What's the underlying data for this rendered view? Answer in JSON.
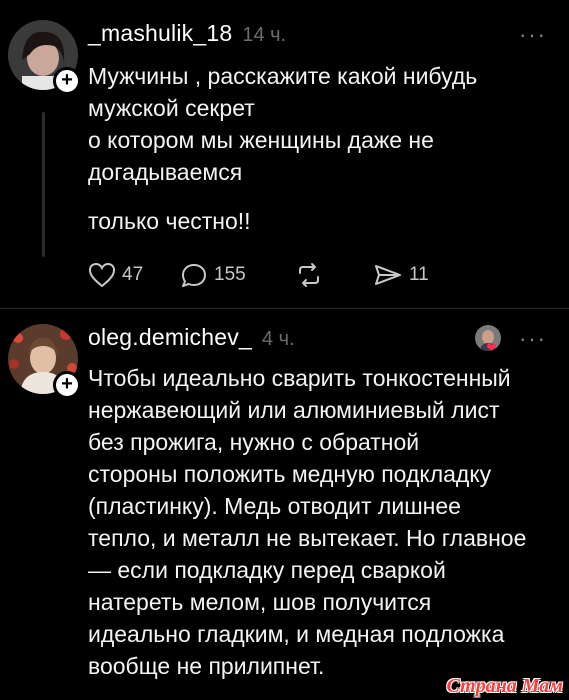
{
  "post1": {
    "username": "_mashulik_18",
    "time": "14 ч.",
    "more": "···",
    "text": "Мужчины , расскажите какой нибудь\nмужской секрет\nо котором мы женщины  даже не\nдогадываемся",
    "text2": "только честно!!",
    "likes": "47",
    "comments": "155",
    "shares": "11",
    "icons": [
      "heart-icon",
      "comment-icon",
      "repost-icon",
      "send-icon"
    ]
  },
  "post2": {
    "username": "oleg.demichev_",
    "time": "4 ч.",
    "more": "···",
    "text": "Чтобы идеально сварить тонкостенный\nнержавеющий или алюминиевый лист\nбез прожига, нужно с обратной\nстороны положить медную подкладку\n(пластинку). Медь отводит лишнее\nтепло, и металл не вытекает. Но главное\n— если подкладку перед сваркой\nнатереть мелом, шов получится\nидеально гладким, и медная подложка\nвообще не прилипнет."
  },
  "watermark": "Страна Мам",
  "colors": {
    "background": "#000000",
    "text": "#f3f3f3",
    "muted": "#6b6b6b",
    "heart": "#ff2d55"
  }
}
